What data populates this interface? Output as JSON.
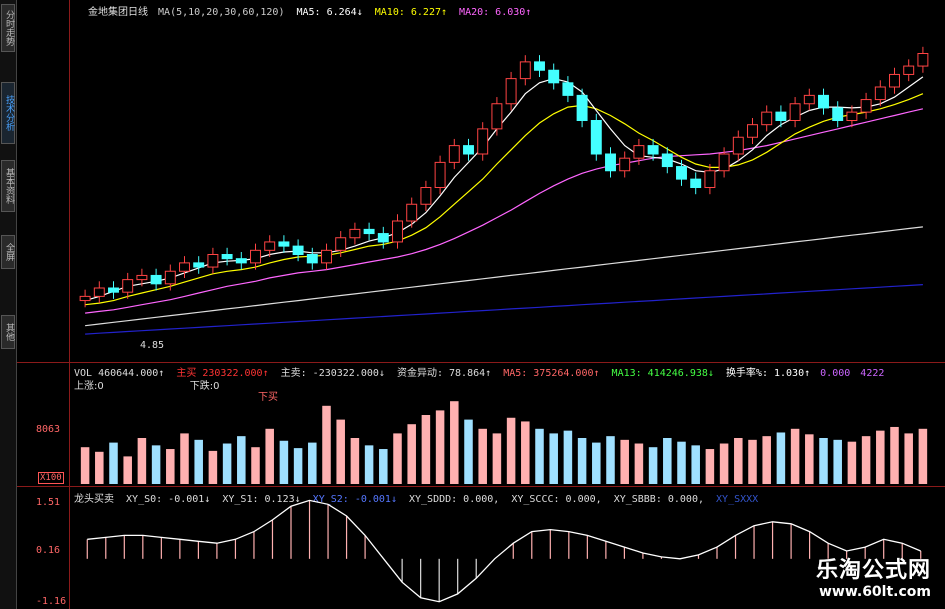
{
  "sidebar": {
    "tabs": [
      {
        "label": "分时走势",
        "active": false
      },
      {
        "label": "技术分析",
        "active": true
      },
      {
        "label": "基本资料",
        "active": false
      },
      {
        "label": "全屏",
        "active": false
      },
      {
        "label": "其他",
        "active": false
      }
    ]
  },
  "price_header": {
    "title": "金地集团日线",
    "ma_params": "MA(5,10,20,30,60,120)",
    "ma5": "MA5: 6.264↓",
    "ma10": "MA10: 6.227↑",
    "ma20": "MA20: 6.030↑",
    "colors": {
      "title": "#e0e0e0",
      "ma5": "#ffffff",
      "ma10": "#ffff00",
      "ma20": "#ff66ff"
    }
  },
  "price_low_label": "4.85",
  "vol_header": {
    "vol": "VOL 460644.000↑",
    "zhumai": "主买",
    "zhumai_val": "230322.000↑",
    "zhumai2": "主卖: -230322.000↓",
    "zijin": "资金异动: 78.864↑",
    "ma5": "MA5: 375264.000↑",
    "ma13": "MA13: 414246.938↓",
    "huanshou": "换手率%: 1.030↑",
    "v1": "0.000",
    "v2": "4222",
    "line2a": "上涨:0",
    "line2b": "下跌:0",
    "mark": "下买"
  },
  "vol_axis": {
    "mid": "8063",
    "low": "X100"
  },
  "ind_header": {
    "name": "龙头买卖",
    "xy_s0": "XY_S0: -0.001↓",
    "xy_s1": "XY_S1: 0.123↓",
    "xy_s2": "XY_S2: -0.001↓",
    "xy_sddd": "XY_SDDD: 0.000,",
    "xy_sccc": "XY_SCCC: 0.000,",
    "xy_sbbb": "XY_SBBB: 0.000,",
    "xy_sxxx": "XY_SXXX"
  },
  "ind_axis": {
    "top": "1.51",
    "mid": "0.16",
    "bot": "-1.16"
  },
  "watermark": {
    "title": "乐淘公式网",
    "url": "www.60lt.com"
  },
  "chart_data": {
    "type": "candlestick",
    "panels": [
      "price",
      "volume",
      "indicator"
    ],
    "price": {
      "close": [
        5.3,
        5.4,
        5.35,
        5.5,
        5.55,
        5.45,
        5.6,
        5.7,
        5.65,
        5.8,
        5.75,
        5.7,
        5.85,
        5.95,
        5.9,
        5.8,
        5.7,
        5.85,
        6.0,
        6.1,
        6.05,
        5.95,
        6.2,
        6.4,
        6.6,
        6.9,
        7.1,
        7.0,
        7.3,
        7.6,
        7.9,
        8.1,
        8.0,
        7.85,
        7.7,
        7.4,
        7.0,
        6.8,
        6.95,
        7.1,
        7.0,
        6.85,
        6.7,
        6.6,
        6.8,
        7.0,
        7.2,
        7.35,
        7.5,
        7.4,
        7.6,
        7.7,
        7.55,
        7.4,
        7.5,
        7.65,
        7.8,
        7.95,
        8.05,
        8.2
      ],
      "ma5": [
        5.25,
        5.3,
        5.36,
        5.42,
        5.45,
        5.48,
        5.52,
        5.58,
        5.64,
        5.7,
        5.72,
        5.73,
        5.75,
        5.8,
        5.83,
        5.84,
        5.82,
        5.82,
        5.85,
        5.9,
        5.96,
        6.0,
        6.06,
        6.16,
        6.3,
        6.5,
        6.72,
        6.9,
        7.08,
        7.3,
        7.5,
        7.72,
        7.85,
        7.9,
        7.86,
        7.74,
        7.52,
        7.3,
        7.1,
        6.98,
        6.96,
        6.94,
        6.88,
        6.8,
        6.78,
        6.82,
        6.92,
        7.05,
        7.22,
        7.35,
        7.44,
        7.52,
        7.56,
        7.56,
        7.55,
        7.56,
        7.6,
        7.68,
        7.8,
        7.92
      ],
      "ma10": [
        5.2,
        5.22,
        5.25,
        5.3,
        5.34,
        5.38,
        5.42,
        5.47,
        5.52,
        5.57,
        5.6,
        5.62,
        5.65,
        5.7,
        5.74,
        5.77,
        5.78,
        5.79,
        5.82,
        5.86,
        5.9,
        5.92,
        5.96,
        6.03,
        6.12,
        6.25,
        6.4,
        6.55,
        6.7,
        6.88,
        7.05,
        7.22,
        7.37,
        7.48,
        7.56,
        7.58,
        7.54,
        7.46,
        7.36,
        7.25,
        7.16,
        7.06,
        6.96,
        6.88,
        6.84,
        6.84,
        6.87,
        6.93,
        7.02,
        7.13,
        7.24,
        7.32,
        7.39,
        7.44,
        7.47,
        7.5,
        7.54,
        7.59,
        7.65,
        7.72
      ],
      "ma20": [
        5.1,
        5.12,
        5.14,
        5.17,
        5.2,
        5.23,
        5.26,
        5.3,
        5.34,
        5.38,
        5.42,
        5.45,
        5.48,
        5.52,
        5.55,
        5.58,
        5.6,
        5.62,
        5.65,
        5.68,
        5.71,
        5.74,
        5.77,
        5.81,
        5.86,
        5.92,
        5.99,
        6.07,
        6.15,
        6.24,
        6.33,
        6.43,
        6.53,
        6.62,
        6.7,
        6.77,
        6.82,
        6.86,
        6.89,
        6.92,
        6.95,
        6.97,
        6.98,
        6.99,
        7.0,
        7.02,
        7.04,
        7.07,
        7.1,
        7.14,
        7.18,
        7.22,
        7.26,
        7.3,
        7.34,
        7.38,
        7.42,
        7.46,
        7.5,
        7.54
      ],
      "ma60": [
        4.95,
        4.97,
        4.99,
        5.01,
        5.03,
        5.05,
        5.07,
        5.09,
        5.11,
        5.13,
        5.15,
        5.17,
        5.19,
        5.21,
        5.23,
        5.25,
        5.27,
        5.29,
        5.31,
        5.33,
        5.35,
        5.37,
        5.39,
        5.41,
        5.43,
        5.45,
        5.47,
        5.49,
        5.51,
        5.53,
        5.55,
        5.57,
        5.59,
        5.61,
        5.63,
        5.65,
        5.67,
        5.69,
        5.71,
        5.73,
        5.75,
        5.77,
        5.79,
        5.81,
        5.83,
        5.85,
        5.87,
        5.89,
        5.91,
        5.93,
        5.95,
        5.97,
        5.99,
        6.01,
        6.03,
        6.05,
        6.07,
        6.09,
        6.11,
        6.13
      ],
      "ma120": [
        4.85,
        4.86,
        4.87,
        4.88,
        4.89,
        4.9,
        4.91,
        4.92,
        4.93,
        4.94,
        4.95,
        4.96,
        4.97,
        4.98,
        4.99,
        5.0,
        5.01,
        5.02,
        5.03,
        5.04,
        5.05,
        5.06,
        5.07,
        5.08,
        5.09,
        5.1,
        5.11,
        5.12,
        5.13,
        5.14,
        5.15,
        5.16,
        5.17,
        5.18,
        5.19,
        5.2,
        5.21,
        5.22,
        5.23,
        5.24,
        5.25,
        5.26,
        5.27,
        5.28,
        5.29,
        5.3,
        5.31,
        5.32,
        5.33,
        5.34,
        5.35,
        5.36,
        5.37,
        5.38,
        5.39,
        5.4,
        5.41,
        5.42,
        5.43,
        5.44
      ],
      "ylim": [
        4.6,
        8.6
      ]
    },
    "volume": {
      "values": [
        40,
        35,
        45,
        30,
        50,
        42,
        38,
        55,
        48,
        36,
        44,
        52,
        40,
        60,
        47,
        39,
        45,
        85,
        70,
        50,
        42,
        38,
        55,
        65,
        75,
        80,
        90,
        70,
        60,
        55,
        72,
        68,
        60,
        55,
        58,
        50,
        45,
        52,
        48,
        44,
        40,
        50,
        46,
        42,
        38,
        44,
        50,
        48,
        52,
        56,
        60,
        54,
        50,
        48,
        46,
        52,
        58,
        62,
        55,
        60
      ],
      "ylim": [
        0,
        100
      ]
    },
    "indicator": {
      "values": [
        0.5,
        0.55,
        0.6,
        0.6,
        0.55,
        0.5,
        0.45,
        0.4,
        0.5,
        0.7,
        1.0,
        1.35,
        1.5,
        1.4,
        1.1,
        0.6,
        0.0,
        -0.6,
        -1.0,
        -1.1,
        -0.9,
        -0.5,
        0.0,
        0.4,
        0.7,
        0.75,
        0.7,
        0.6,
        0.45,
        0.3,
        0.15,
        0.05,
        0.0,
        0.1,
        0.3,
        0.6,
        0.85,
        0.95,
        0.9,
        0.7,
        0.4,
        0.2,
        0.3,
        0.5,
        0.4,
        0.2
      ],
      "ylim": [
        -1.16,
        1.51
      ]
    }
  }
}
